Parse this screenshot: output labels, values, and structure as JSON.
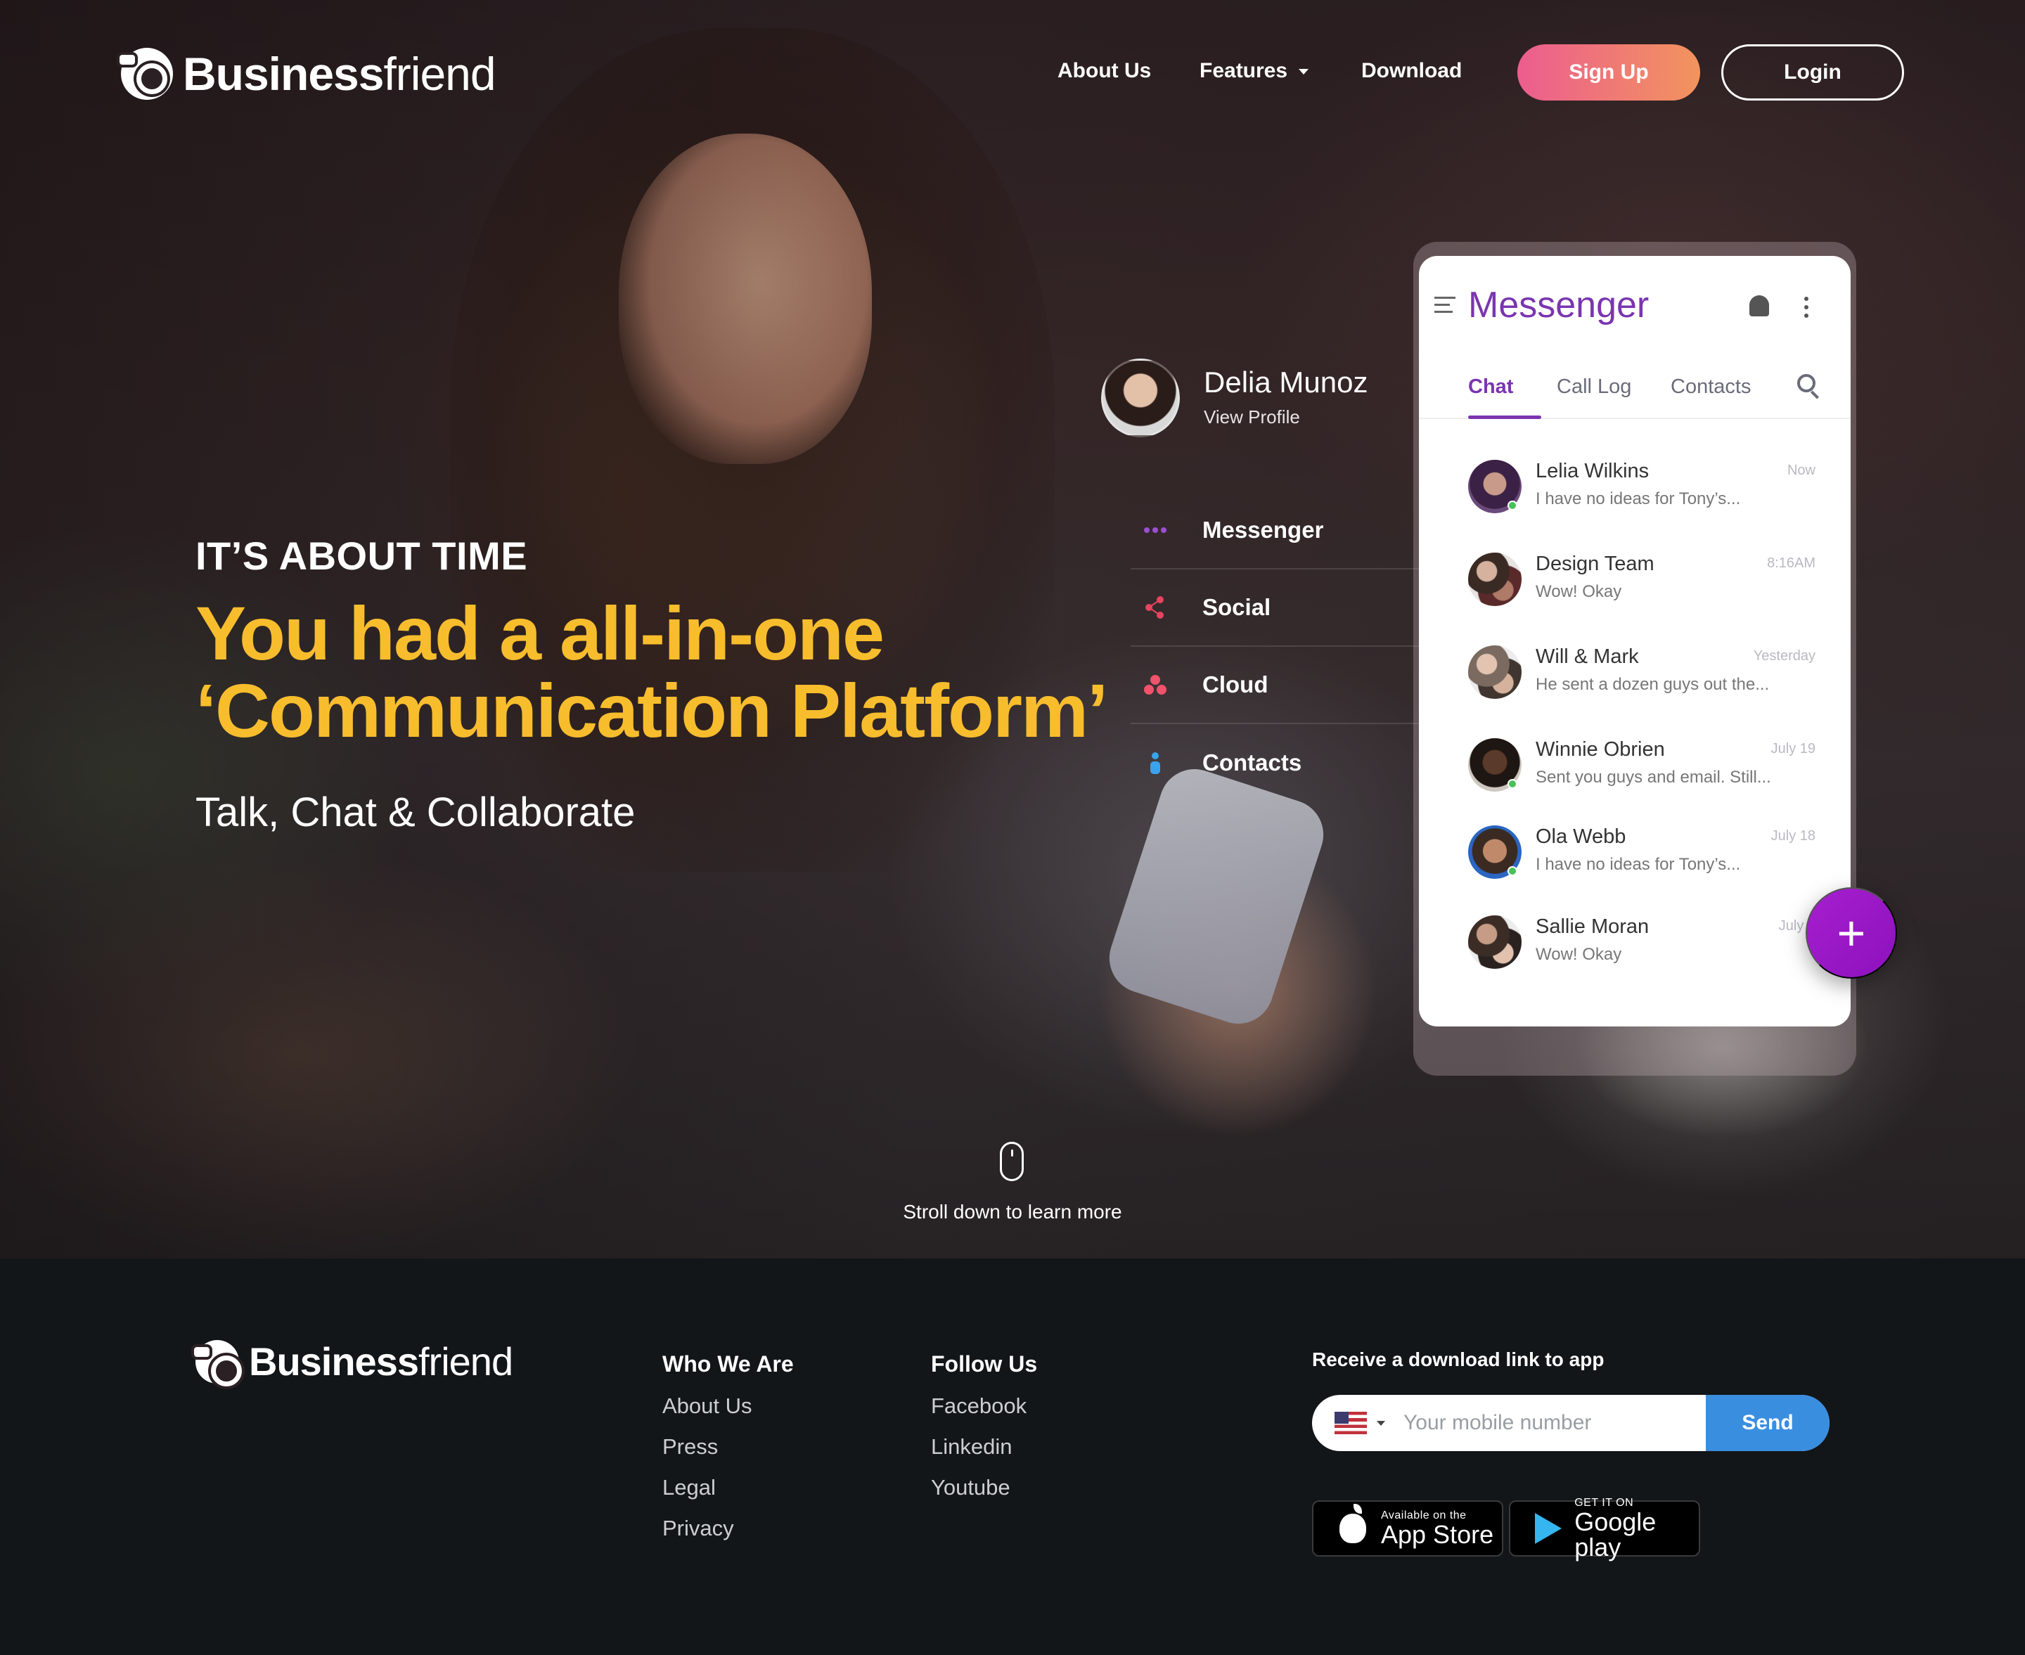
{
  "brand": {
    "bold": "Business",
    "light": "friend"
  },
  "nav": {
    "about": "About Us",
    "features": "Features",
    "download": "Download",
    "signup": "Sign Up",
    "login": "Login"
  },
  "hero": {
    "eyebrow": "IT’S ABOUT TIME",
    "headline_line1": "You had a all-in-one",
    "headline_line2": "‘Communication Platform’",
    "subline": "Talk, Chat & Collaborate",
    "scroll_hint": "Stroll down to learn more"
  },
  "profile": {
    "name": "Delia Munoz",
    "link": "View Profile"
  },
  "features_menu": [
    {
      "label": "Messenger",
      "icon": "dots-icon",
      "color": "#9b4fd4"
    },
    {
      "label": "Social",
      "icon": "share-icon",
      "color": "#e8445f"
    },
    {
      "label": "Cloud",
      "icon": "cloud-icon",
      "color": "#f0536b"
    },
    {
      "label": "Contacts",
      "icon": "person-icon",
      "color": "#3aa3ee"
    }
  ],
  "messenger": {
    "title": "Messenger",
    "tabs": [
      "Chat",
      "Call Log",
      "Contacts"
    ],
    "active_tab": "Chat",
    "chats": [
      {
        "name": "Lelia Wilkins",
        "preview": "I have no ideas for Tony’s...",
        "time": "Now",
        "online": true
      },
      {
        "name": "Design Team",
        "preview": "Wow! Okay",
        "time": "8:16AM",
        "online": false
      },
      {
        "name": "Will & Mark",
        "preview": "He sent a dozen guys out the...",
        "time": "Yesterday",
        "online": false
      },
      {
        "name": "Winnie Obrien",
        "preview": "Sent you guys and email. Still...",
        "time": "July 19",
        "online": true
      },
      {
        "name": "Ola Webb",
        "preview": "I have no ideas for Tony’s...",
        "time": "July 18",
        "online": true
      },
      {
        "name": "Sallie Moran",
        "preview": "Wow! Okay",
        "time": "July 1",
        "online": false
      }
    ]
  },
  "footer": {
    "col1_title": "Who We Are",
    "col1_links": [
      "About Us",
      "Press",
      "Legal",
      "Privacy"
    ],
    "col2_title": "Follow Us",
    "col2_links": [
      "Facebook",
      "Linkedin",
      "Youtube"
    ],
    "download_title": "Receive a download link to app",
    "phone_placeholder": "Your mobile number",
    "send": "Send",
    "appstore_small": "Available on the",
    "appstore_big": "App Store",
    "googleplay_small": "GET IT ON",
    "googleplay_big": "Google play"
  },
  "colors": {
    "accent_yellow": "#f8bd2d",
    "messenger_purple": "#7a35b0",
    "fab_purple": "#9c18c9",
    "send_blue": "#3a8ee0",
    "signup_gradient_start": "#ec5d8f",
    "signup_gradient_end": "#f2945d"
  }
}
